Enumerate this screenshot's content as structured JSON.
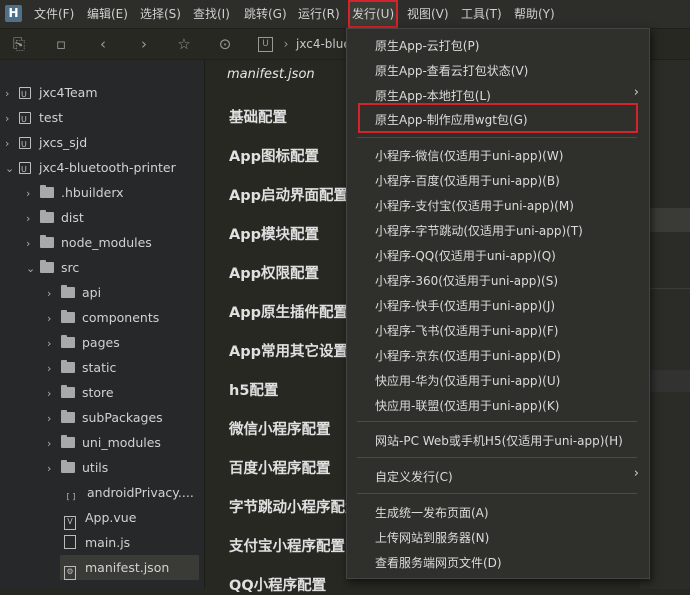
{
  "menubar": {
    "logo": "H",
    "items": [
      "文件(F)",
      "编辑(E)",
      "选择(S)",
      "查找(I)",
      "跳转(G)",
      "运行(R)",
      "发行(U)",
      "视图(V)",
      "工具(T)",
      "帮助(Y)"
    ]
  },
  "toolbar": {
    "breadcrumb": "jxc4-blue"
  },
  "sidebar": {
    "projects": [
      "jxc4Team",
      "test",
      "jxcs_sjd",
      "jxc4-bluetooth-printer"
    ],
    "folders": [
      ".hbuilderx",
      "dist",
      "node_modules",
      "src"
    ],
    "src_folders": [
      "api",
      "components",
      "pages",
      "static",
      "store",
      "subPackages",
      "uni_modules",
      "utils"
    ],
    "files": [
      "androidPrivacy....",
      "App.vue",
      "main.js",
      "manifest.json"
    ]
  },
  "editor": {
    "title": "manifest.json",
    "sections": [
      "基础配置",
      "App图标配置",
      "App启动界面配置",
      "App模块配置",
      "App权限配置",
      "App原生插件配置",
      "App常用其它设置",
      "h5配置",
      "微信小程序配置",
      "百度小程序配置",
      "字节跳动小程序配置",
      "支付宝小程序配置",
      "QQ小程序配置"
    ]
  },
  "dropdown": {
    "items": [
      "原生App-云打包(P)",
      "原生App-查看云打包状态(V)",
      "原生App-本地打包(L)",
      "原生App-制作应用wgt包(G)",
      "小程序-微信(仅适用于uni-app)(W)",
      "小程序-百度(仅适用于uni-app)(B)",
      "小程序-支付宝(仅适用于uni-app)(M)",
      "小程序-字节跳动(仅适用于uni-app)(T)",
      "小程序-QQ(仅适用于uni-app)(Q)",
      "小程序-360(仅适用于uni-app)(S)",
      "小程序-快手(仅适用于uni-app)(J)",
      "小程序-飞书(仅适用于uni-app)(F)",
      "小程序-京东(仅适用于uni-app)(D)",
      "快应用-华为(仅适用于uni-app)(U)",
      "快应用-联盟(仅适用于uni-app)(K)",
      "网站-PC Web或手机H5(仅适用于uni-app)(H)",
      "自定义发行(C)",
      "生成统一发布页面(A)",
      "上传网站到服务器(N)",
      "查看服务端网页文件(D)"
    ]
  },
  "colors": {
    "highlight": "#d6222a",
    "link": "#4aa3ff"
  }
}
